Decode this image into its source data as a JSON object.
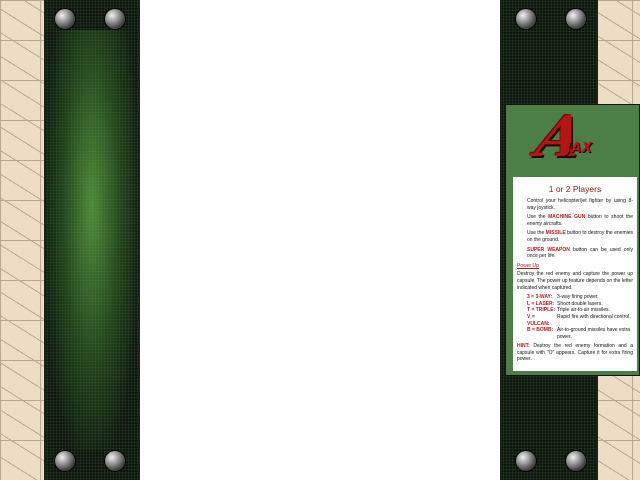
{
  "logo": {
    "letter": "A",
    "rest": "JAX"
  },
  "instructions": {
    "title": "1 or 2 Players",
    "lines": [
      {
        "plain": "Control your helicopter/jet fighter by using 8-way joystick."
      },
      {
        "pre": "Use the ",
        "highlight": "MACHINE GUN",
        "post": " button to shoot the enemy aircrafts."
      },
      {
        "pre": "Use the ",
        "highlight": "MISSILE",
        "post": " button to destroy the enemies on the ground."
      },
      {
        "pre": "",
        "highlight": "SUPER WEAPON",
        "post": " button can be used only once per life."
      }
    ],
    "powerup_heading": "Power Up",
    "powerup_intro": "Destroy the red enemy and capture the power up capsule. The power up feature depends on the letter indicated when captured.",
    "powerups": [
      {
        "key": "3 = 3-WAY:",
        "desc": "3-way firing power."
      },
      {
        "key": "L = LASER:",
        "desc": "Shoot double lasers."
      },
      {
        "key": "T = TRIPLE:",
        "desc": "Triple air-to-air missiles."
      },
      {
        "key": "V = VULCAN:",
        "desc": "Rapid fire with directional control."
      },
      {
        "key": "B = BOMB:",
        "desc": "Air-to-ground missiles have extra power."
      }
    ],
    "hint_label": "HINT:",
    "hint_text": " Destroy the red enemy formation and a capsule with \"O\" appears. Capture it for extra firing power."
  },
  "colors": {
    "logo_red": "#b41515",
    "card_green": "#4c7f46",
    "panel_glow_green": "#60aa46",
    "highlight_red": "#b11a1a"
  }
}
